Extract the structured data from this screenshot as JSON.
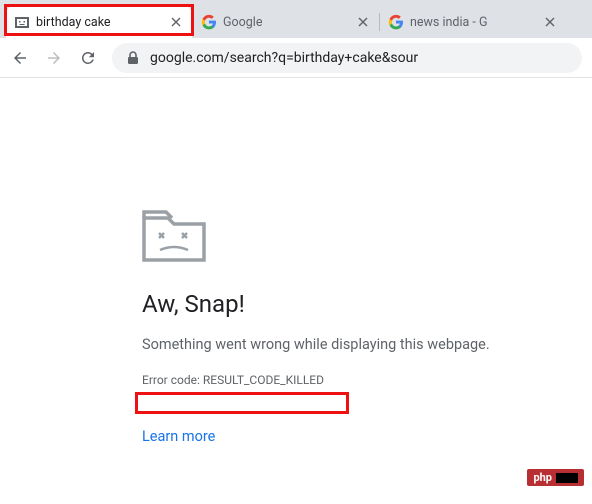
{
  "tabs": [
    {
      "title": "birthday cake",
      "favicon": "sad-page-icon",
      "active": true
    },
    {
      "title": "Google",
      "favicon": "google-icon",
      "active": false
    },
    {
      "title": "news india - G",
      "favicon": "google-icon",
      "active": false
    }
  ],
  "addressbar": {
    "url": "google.com/search?q=birthday+cake&sour"
  },
  "error_page": {
    "title": "Aw, Snap!",
    "message": "Something went wrong while displaying this webpage.",
    "error_code": "Error code: RESULT_CODE_KILLED",
    "learn_more": "Learn more"
  },
  "watermark": {
    "text": "php"
  }
}
